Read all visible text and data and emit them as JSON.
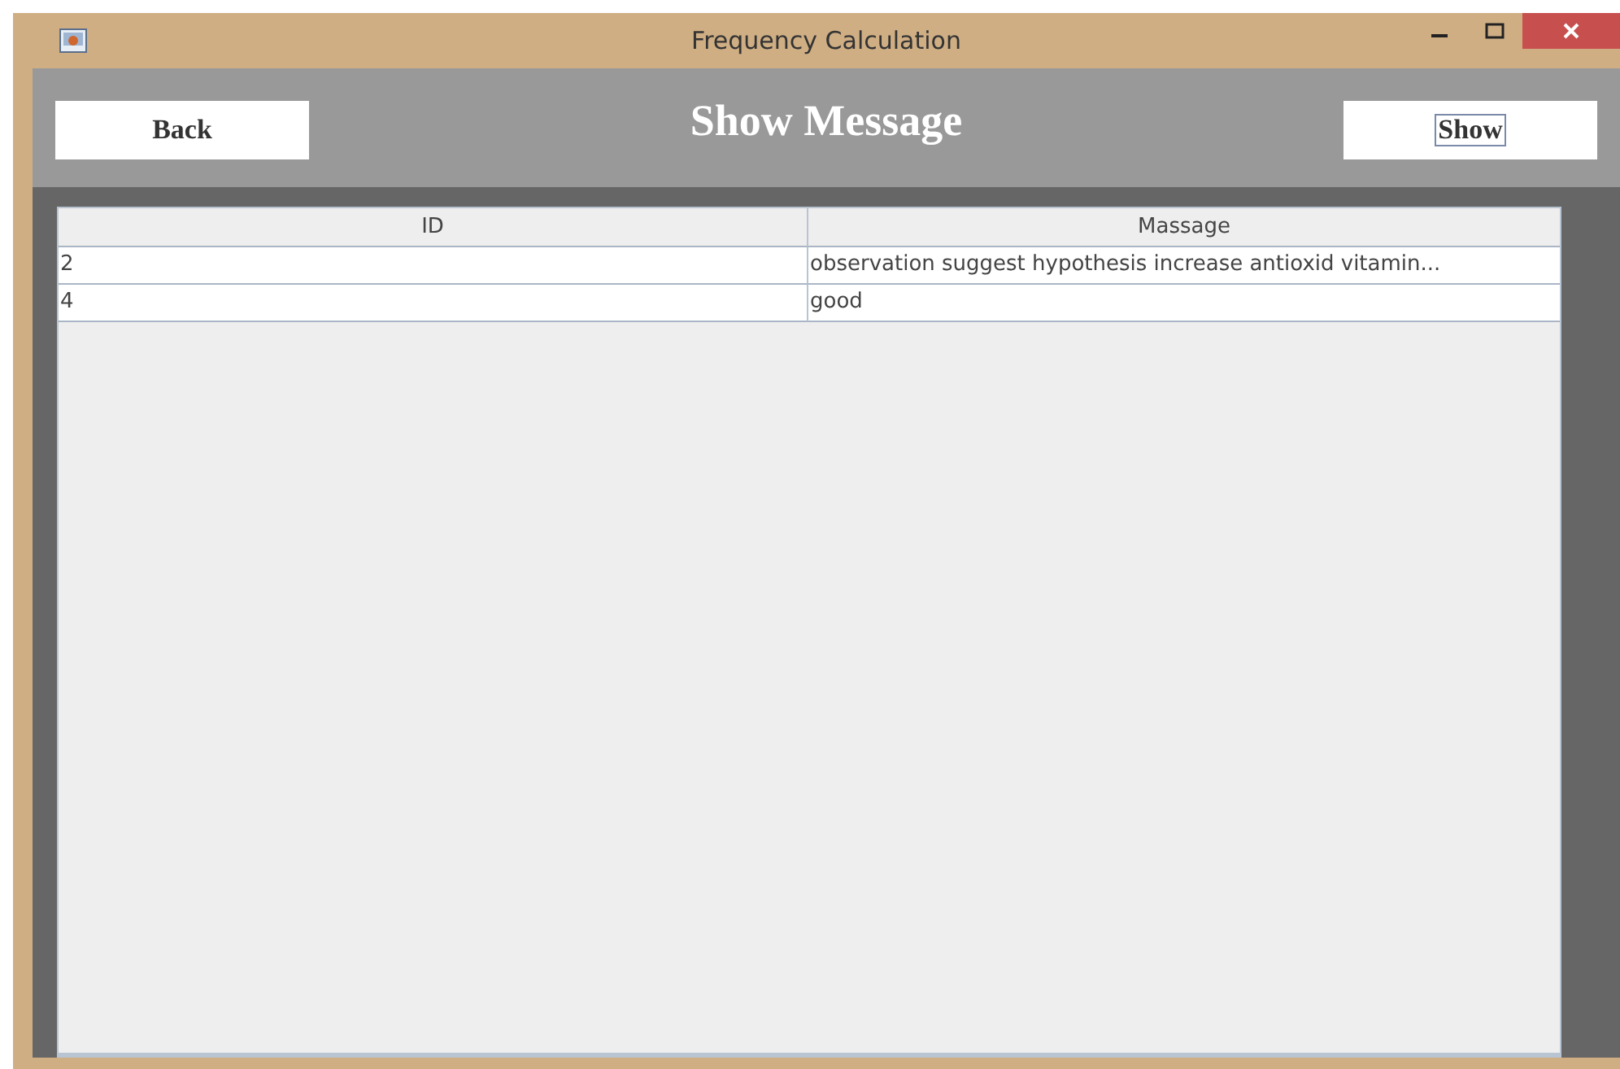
{
  "window": {
    "title": "Frequency Calculation"
  },
  "header": {
    "back_button": "Back",
    "title": "Show Message",
    "show_button": "Show"
  },
  "table": {
    "columns": [
      "ID",
      "Massage"
    ],
    "rows": [
      {
        "cells": [
          "2",
          "observation suggest hypothesis increase antioxid vitamin..."
        ]
      },
      {
        "cells": [
          "4",
          "good"
        ]
      }
    ]
  }
}
